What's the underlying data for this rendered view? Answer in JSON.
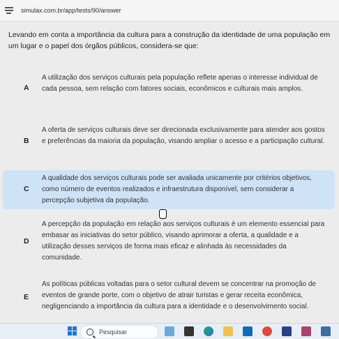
{
  "browser": {
    "url": "simulax.com.br/app/tests/90/answer"
  },
  "question": {
    "text": "Levando em conta a importância da cultura para a construção da identidade de uma população em um lugar e o papel dos órgãos públicos, considera-se que:"
  },
  "options": [
    {
      "letter": "A",
      "text": "A utilização dos serviços culturais pela população reflete apenas o interesse individual de cada pessoa, sem relação com fatores sociais, econômicos e culturais mais amplos.",
      "selected": false
    },
    {
      "letter": "B",
      "text": "A oferta de serviços culturais deve ser direcionada exclusivamente para atender aos gostos e preferências da maioria da população, visando ampliar o acesso e a participação cultural.",
      "selected": false
    },
    {
      "letter": "C",
      "text": "A qualidade dos serviços culturais pode ser avaliada unicamente por critérios objetivos, como número de eventos realizados e infraestrutura disponível, sem considerar a percepção subjetiva da população.",
      "selected": true
    },
    {
      "letter": "D",
      "text": "A percepção da população em relação aos serviços culturais é um elemento essencial para embasar as iniciativas do setor público, visando aprimorar a oferta, a qualidade e a utilização desses serviços de forma mais eficaz e alinhada às necessidades da comunidade.",
      "selected": false
    },
    {
      "letter": "E",
      "text": "As políticas públicas voltadas para o setor cultural devem se concentrar na promoção de eventos de grande porte, com o objetivo de atrair turistas e gerar receita econômica, negligenciando a importância da cultura para a identidade e o desenvolvimento social.",
      "selected": false
    }
  ],
  "taskbar": {
    "search_label": "Pesquisar",
    "colors": {
      "accent": "#1b74d4",
      "selected_option": "#cfe3f7"
    }
  }
}
